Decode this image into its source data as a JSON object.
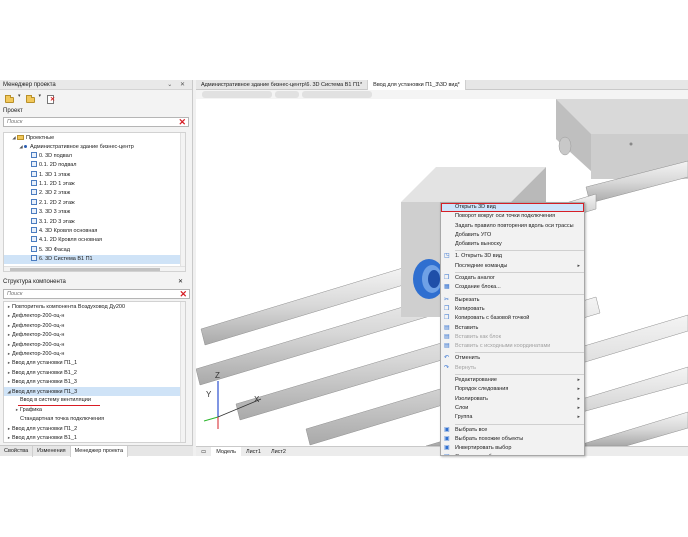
{
  "left_panel": {
    "title": "Менеджер проекта",
    "project_label": "Проект",
    "search_placeholder": "Поиск",
    "project_tree": [
      {
        "label": "Проектные",
        "type": "folder",
        "indent": 1
      },
      {
        "label": "Административное здание бизнес-центр",
        "type": "dot",
        "indent": 2
      },
      {
        "label": "0. 3D подвал",
        "type": "3d",
        "indent": 3
      },
      {
        "label": "0.1. 2D подвал",
        "type": "3d",
        "indent": 3
      },
      {
        "label": "1. 3D 1 этаж",
        "type": "3d",
        "indent": 3
      },
      {
        "label": "1.1. 2D 1 этаж",
        "type": "3d",
        "indent": 3
      },
      {
        "label": "2. 3D 2 этаж",
        "type": "3d",
        "indent": 3
      },
      {
        "label": "2.1. 2D 2 этаж",
        "type": "3d",
        "indent": 3
      },
      {
        "label": "3. 3D 3 этаж",
        "type": "3d",
        "indent": 3
      },
      {
        "label": "3.1. 2D 3 этаж",
        "type": "3d",
        "indent": 3
      },
      {
        "label": "4. 3D Кровля основная",
        "type": "3d",
        "indent": 3
      },
      {
        "label": "4.1. 2D Кровля основная",
        "type": "3d",
        "indent": 3
      },
      {
        "label": "5. 3D Фасад",
        "type": "3d",
        "indent": 3
      },
      {
        "label": "6. 3D Система В1 П1",
        "type": "3d",
        "indent": 3,
        "selected": true
      }
    ],
    "structure_title": "Структура компонента",
    "structure_search_placeholder": "Поиск",
    "structure_tree": [
      {
        "label": "Повторитель компонента Воздуховод Ду200",
        "exp": "▸",
        "indent": 1
      },
      {
        "label": "Дефлектор-200-оц-н",
        "exp": "▸",
        "indent": 1
      },
      {
        "label": "Дефлектор-200-оц-н",
        "exp": "▸",
        "indent": 1
      },
      {
        "label": "Дефлектор-200-оц-н",
        "exp": "▸",
        "indent": 1
      },
      {
        "label": "Дефлектор-200-оц-н",
        "exp": "▸",
        "indent": 1
      },
      {
        "label": "Дефлектор-200-оц-н",
        "exp": "▸",
        "indent": 1
      },
      {
        "label": "Ввод для установки П1_1",
        "exp": "▸",
        "indent": 1
      },
      {
        "label": "Ввод для установки В1_2",
        "exp": "▸",
        "indent": 1
      },
      {
        "label": "Ввод для установки В1_3",
        "exp": "▸",
        "indent": 1
      },
      {
        "label": "Ввод для установки П1_3",
        "exp": "◢",
        "indent": 1,
        "selected": true
      },
      {
        "label": "Ввод в систему вентиляции",
        "exp": "",
        "indent": 2
      },
      {
        "label": "Графика",
        "exp": "▸",
        "indent": 2
      },
      {
        "label": "Стандартная точка подключения",
        "exp": "",
        "indent": 2
      },
      {
        "label": "Ввод для установки П1_2",
        "exp": "▸",
        "indent": 1
      },
      {
        "label": "Ввод для установки В1_1",
        "exp": "▸",
        "indent": 1
      }
    ],
    "bottom_tabs": [
      "Свойства",
      "Изменения",
      "Менеджер проекта"
    ]
  },
  "doc_tabs": [
    "Административное здание бизнес-центр\\6. 3D Система В1 П1*",
    "Ввод для установки П1_3\\3D вид*"
  ],
  "model_tabs": [
    "Модель",
    "Лист1",
    "Лист2"
  ],
  "axes": {
    "z": "Z",
    "y": "Y",
    "x": "X"
  },
  "context_menu": [
    {
      "label": "Открыть 3D вид",
      "highlight": true
    },
    {
      "label": "Поворот вокруг оси точки подключения"
    },
    {
      "label": "Задать правило повторения вдоль оси трассы"
    },
    {
      "label": "Добавить УГО"
    },
    {
      "label": "Добавить выноску"
    },
    {
      "sep": true
    },
    {
      "label": "1. Открыть 3D вид",
      "icon": "view-icon"
    },
    {
      "label": "Последние команды",
      "submenu": true
    },
    {
      "sep": true
    },
    {
      "label": "Создать аналог",
      "icon": "copy-icon"
    },
    {
      "label": "Создание блока...",
      "icon": "block-icon"
    },
    {
      "sep": true
    },
    {
      "label": "Вырезать",
      "icon": "cut-icon"
    },
    {
      "label": "Копировать",
      "icon": "copy-icon"
    },
    {
      "label": "Копировать с базовой точкой",
      "icon": "copy-icon"
    },
    {
      "label": "Вставить",
      "icon": "paste-icon"
    },
    {
      "label": "Вставить как блок",
      "disabled": true,
      "icon": "paste-icon"
    },
    {
      "label": "Вставить с исходными координатами",
      "disabled": true,
      "icon": "paste-icon"
    },
    {
      "sep": true
    },
    {
      "label": "Отменить",
      "icon": "undo-icon"
    },
    {
      "label": "Вернуть",
      "disabled": true,
      "icon": "redo-icon"
    },
    {
      "sep": true
    },
    {
      "label": "Редактирование",
      "submenu": true
    },
    {
      "label": "Порядок следования",
      "submenu": true
    },
    {
      "label": "Изолировать",
      "submenu": true
    },
    {
      "label": "Слои",
      "submenu": true
    },
    {
      "label": "Группа",
      "submenu": true
    },
    {
      "sep": true
    },
    {
      "label": "Выбрать все",
      "icon": "select-icon"
    },
    {
      "label": "Выбрать похожие объекты",
      "icon": "select-icon"
    },
    {
      "label": "Инвертировать выбор",
      "icon": "select-icon"
    },
    {
      "label": "Отменить выбор",
      "icon": "select-icon"
    }
  ],
  "colors": {
    "accent_red": "#d61f26",
    "selection": "#cfe3f7",
    "icon_blue": "#2f6fd0"
  }
}
